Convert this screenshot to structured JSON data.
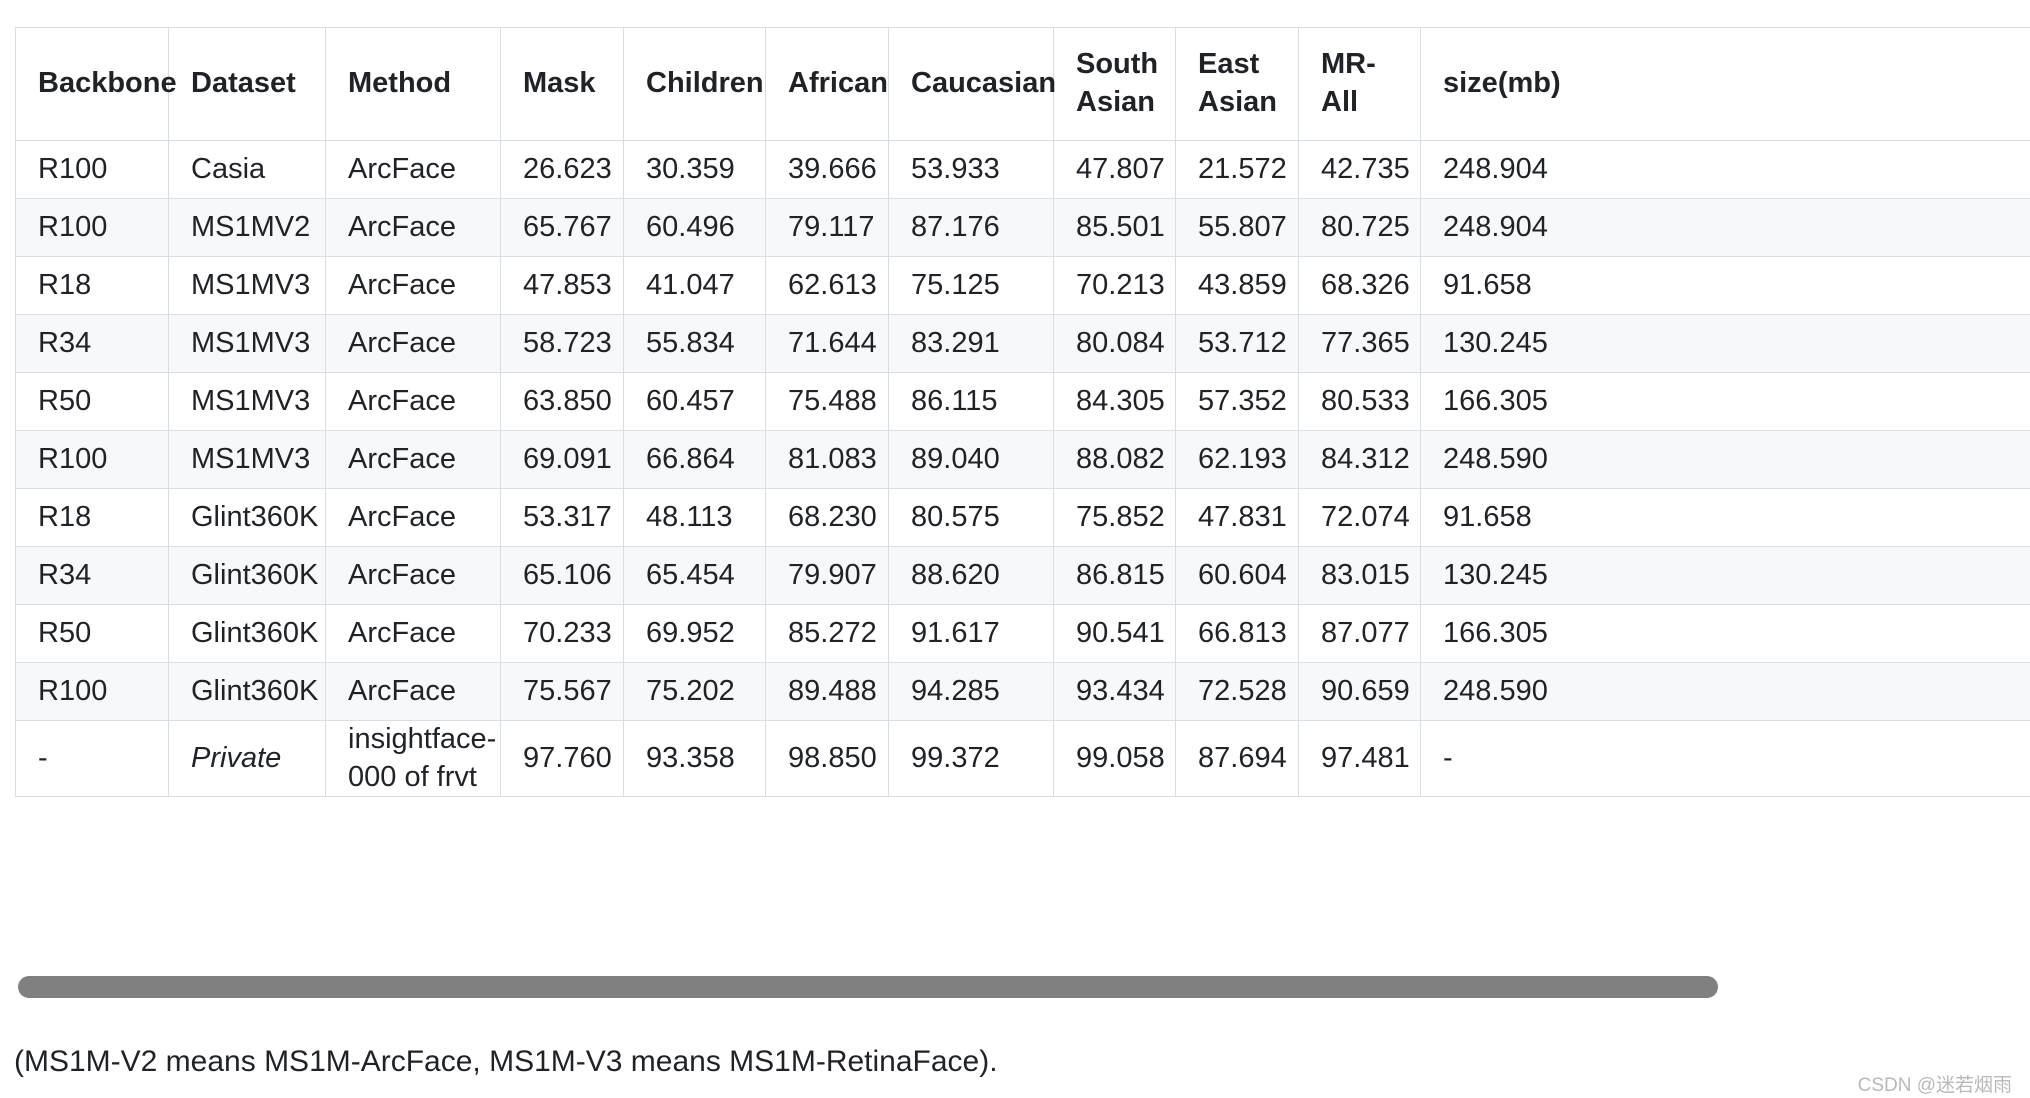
{
  "table": {
    "columns": [
      "Backbone",
      "Dataset",
      "Method",
      "Mask",
      "Children",
      "African",
      "Caucasian",
      "South Asian",
      "East Asian",
      "MR-All",
      "size(mb)"
    ],
    "rows": [
      {
        "backbone": "R100",
        "dataset": "Casia",
        "method": "ArcFace",
        "mask": "26.623",
        "children": "30.359",
        "african": "39.666",
        "caucasian": "53.933",
        "south_asian": "47.807",
        "east_asian": "21.572",
        "mr_all": "42.735",
        "size_mb": "248.904"
      },
      {
        "backbone": "R100",
        "dataset": "MS1MV2",
        "method": "ArcFace",
        "mask": "65.767",
        "children": "60.496",
        "african": "79.117",
        "caucasian": "87.176",
        "south_asian": "85.501",
        "east_asian": "55.807",
        "mr_all": "80.725",
        "size_mb": "248.904"
      },
      {
        "backbone": "R18",
        "dataset": "MS1MV3",
        "method": "ArcFace",
        "mask": "47.853",
        "children": "41.047",
        "african": "62.613",
        "caucasian": "75.125",
        "south_asian": "70.213",
        "east_asian": "43.859",
        "mr_all": "68.326",
        "size_mb": "91.658"
      },
      {
        "backbone": "R34",
        "dataset": "MS1MV3",
        "method": "ArcFace",
        "mask": "58.723",
        "children": "55.834",
        "african": "71.644",
        "caucasian": "83.291",
        "south_asian": "80.084",
        "east_asian": "53.712",
        "mr_all": "77.365",
        "size_mb": "130.245"
      },
      {
        "backbone": "R50",
        "dataset": "MS1MV3",
        "method": "ArcFace",
        "mask": "63.850",
        "children": "60.457",
        "african": "75.488",
        "caucasian": "86.115",
        "south_asian": "84.305",
        "east_asian": "57.352",
        "mr_all": "80.533",
        "size_mb": "166.305"
      },
      {
        "backbone": "R100",
        "dataset": "MS1MV3",
        "method": "ArcFace",
        "mask": "69.091",
        "children": "66.864",
        "african": "81.083",
        "caucasian": "89.040",
        "south_asian": "88.082",
        "east_asian": "62.193",
        "mr_all": "84.312",
        "size_mb": "248.590"
      },
      {
        "backbone": "R18",
        "dataset": "Glint360K",
        "method": "ArcFace",
        "mask": "53.317",
        "children": "48.113",
        "african": "68.230",
        "caucasian": "80.575",
        "south_asian": "75.852",
        "east_asian": "47.831",
        "mr_all": "72.074",
        "size_mb": "91.658"
      },
      {
        "backbone": "R34",
        "dataset": "Glint360K",
        "method": "ArcFace",
        "mask": "65.106",
        "children": "65.454",
        "african": "79.907",
        "caucasian": "88.620",
        "south_asian": "86.815",
        "east_asian": "60.604",
        "mr_all": "83.015",
        "size_mb": "130.245"
      },
      {
        "backbone": "R50",
        "dataset": "Glint360K",
        "method": "ArcFace",
        "mask": "70.233",
        "children": "69.952",
        "african": "85.272",
        "caucasian": "91.617",
        "south_asian": "90.541",
        "east_asian": "66.813",
        "mr_all": "87.077",
        "size_mb": "166.305"
      },
      {
        "backbone": "R100",
        "dataset": "Glint360K",
        "method": "ArcFace",
        "mask": "75.567",
        "children": "75.202",
        "african": "89.488",
        "caucasian": "94.285",
        "south_asian": "93.434",
        "east_asian": "72.528",
        "mr_all": "90.659",
        "size_mb": "248.590"
      },
      {
        "backbone": "-",
        "dataset": "Private",
        "method": "insightface-000 of frvt",
        "mask": "97.760",
        "children": "93.358",
        "african": "98.850",
        "caucasian": "99.372",
        "south_asian": "99.058",
        "east_asian": "87.694",
        "mr_all": "97.481",
        "size_mb": "-"
      }
    ]
  },
  "caption": "(MS1M-V2 means MS1M-ArcFace, MS1M-V3 means MS1M-RetinaFace).",
  "watermark": "CSDN @迷若烟雨",
  "colors": {
    "border": "#d8dee4",
    "row_alt_bg": "#f6f8fa",
    "text": "#1f2328",
    "scrollbar_thumb": "#808080",
    "watermark": "#b9b9b9"
  }
}
